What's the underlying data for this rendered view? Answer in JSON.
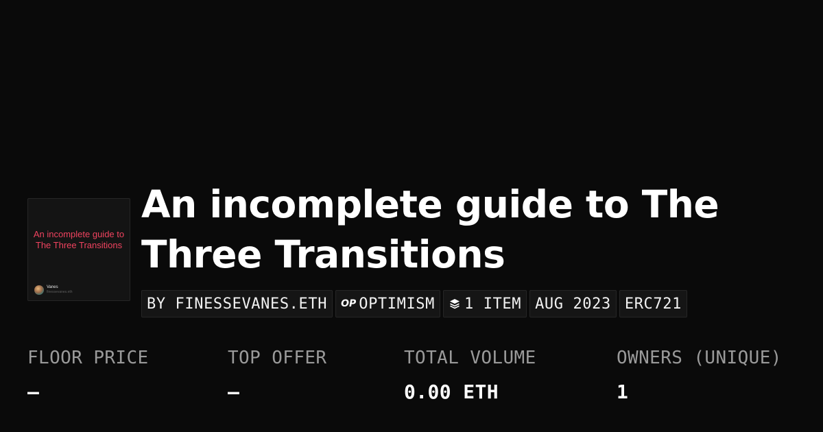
{
  "collection": {
    "title": "An incomplete guide to The Three Transitions",
    "thumbnail": {
      "title": "An incomplete guide to The Three Transitions",
      "author_name": "Vanes",
      "author_handle": "finessevanes.eth",
      "title_color": "#f0435f"
    },
    "tags": {
      "creator": "BY FINESSEVANES.ETH",
      "chain_icon": "OP",
      "chain": "OPTIMISM",
      "items_icon": "layers-icon",
      "items": "1 ITEM",
      "date": "AUG 2023",
      "standard": "ERC721"
    }
  },
  "stats": [
    {
      "label": "FLOOR PRICE",
      "value": "–"
    },
    {
      "label": "TOP OFFER",
      "value": "–"
    },
    {
      "label": "TOTAL VOLUME",
      "value": "0.00 ETH"
    },
    {
      "label": "OWNERS (UNIQUE)",
      "value": "1"
    }
  ],
  "colors": {
    "background": "#0a0a0a",
    "chip_background": "#151515",
    "label": "#9a9a9a",
    "accent": "#f0435f"
  }
}
